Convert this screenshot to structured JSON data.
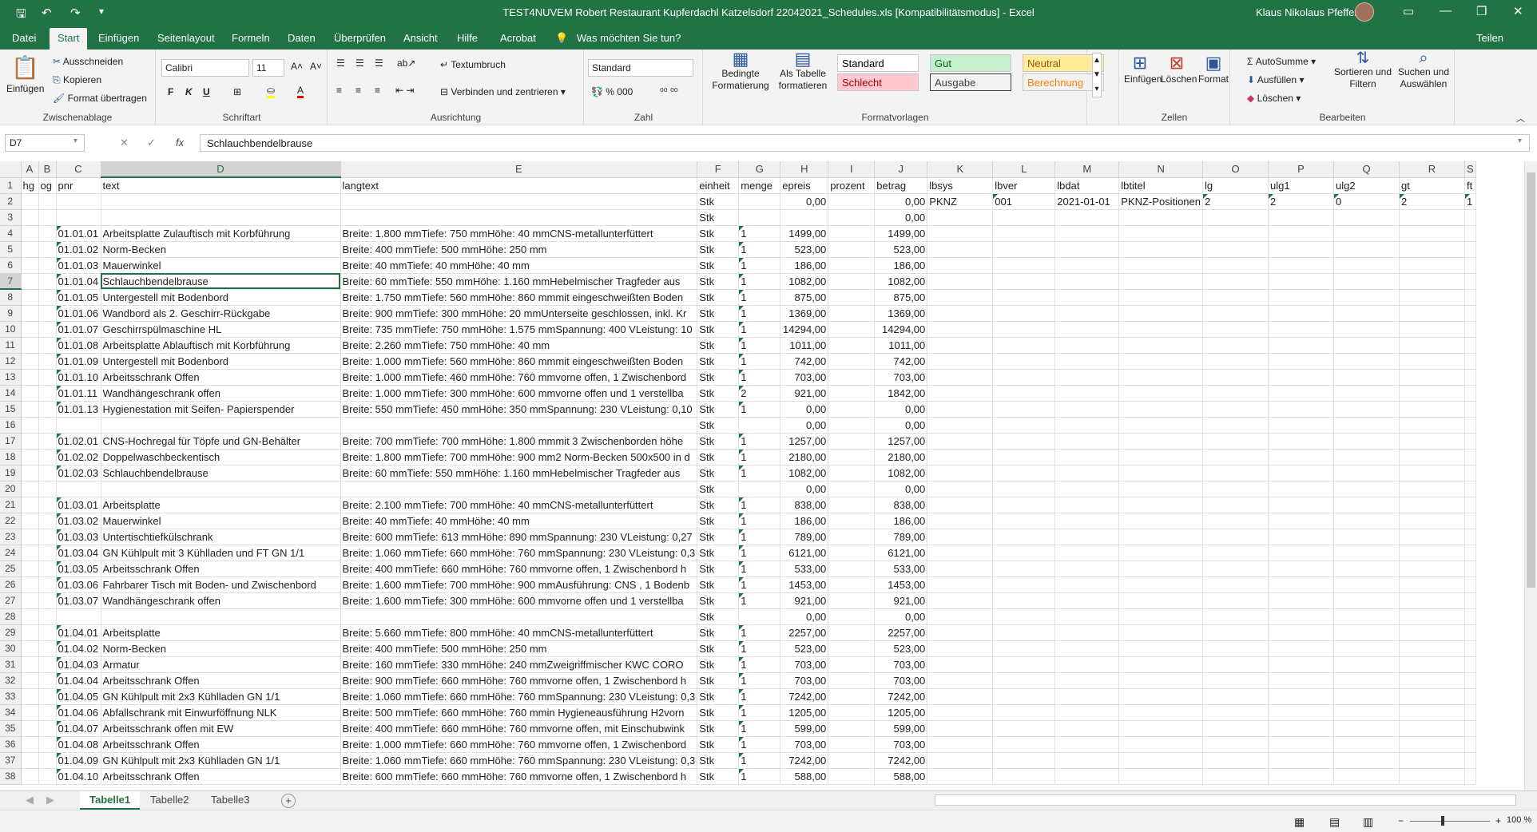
{
  "window": {
    "title": "TEST4NUVEM Robert Restaurant Kupferdachl Katzelsdorf 22042021_Schedules.xls  [Kompatibilitätsmodus]  -  Excel",
    "user": "Klaus Nikolaus Pfeffer"
  },
  "menu": {
    "items": [
      "Datei",
      "Start",
      "Einfügen",
      "Seitenlayout",
      "Formeln",
      "Daten",
      "Überprüfen",
      "Ansicht",
      "Hilfe",
      "Acrobat"
    ],
    "tell_me": "Was möchten Sie tun?",
    "share": "Teilen"
  },
  "ribbon": {
    "clipboard": {
      "label": "Zwischenablage",
      "paste": "Einfügen",
      "cut": "Ausschneiden",
      "copy": "Kopieren",
      "format_painter": "Format übertragen"
    },
    "font": {
      "label": "Schriftart",
      "name": "Calibri",
      "size": "11",
      "bold": "F",
      "italic": "K",
      "underline": "U"
    },
    "alignment": {
      "label": "Ausrichtung",
      "wrap": "Textumbruch",
      "merge": "Verbinden und zentrieren"
    },
    "number": {
      "label": "Zahl",
      "format": "Standard"
    },
    "styles": {
      "label": "Formatvorlagen",
      "conditional": "Bedingte Formatierung",
      "as_table": "Als Tabelle formatieren",
      "cells": [
        {
          "name": "Standard",
          "bg": "#ffffff",
          "fg": "#000000"
        },
        {
          "name": "Gut",
          "bg": "#c6efce",
          "fg": "#006100"
        },
        {
          "name": "Neutral",
          "bg": "#ffeb9c",
          "fg": "#9c5700"
        },
        {
          "name": "Schlecht",
          "bg": "#ffc7ce",
          "fg": "#9c0006"
        },
        {
          "name": "Ausgabe",
          "bg": "#f2f2f2",
          "fg": "#3f3f3f"
        },
        {
          "name": "Berechnung",
          "bg": "#f2f2f2",
          "fg": "#fa7d00"
        }
      ]
    },
    "cells": {
      "label": "Zellen",
      "insert": "Einfügen",
      "delete": "Löschen",
      "format": "Format"
    },
    "editing": {
      "label": "Bearbeiten",
      "autosum": "AutoSumme",
      "fill": "Ausfüllen",
      "clear": "Löschen",
      "sort": "Sortieren und Filtern",
      "find": "Suchen und Auswählen"
    }
  },
  "formula_bar": {
    "name_box": "D7",
    "value": "Schlauchbendelbrause"
  },
  "columns": [
    "A",
    "B",
    "C",
    "D",
    "E",
    "F",
    "G",
    "H",
    "I",
    "J",
    "K",
    "L",
    "M",
    "N",
    "O",
    "P",
    "Q",
    "R",
    "S"
  ],
  "rows": [
    [
      "hg",
      "og",
      "pnr",
      "text",
      "langtext",
      "einheit",
      "menge",
      "epreis",
      "prozent",
      "betrag",
      "lbsys",
      "lbver",
      "lbdat",
      "lbtitel",
      "lg",
      "ulg1",
      "ulg2",
      "gt",
      "ft"
    ],
    [
      "",
      "",
      "",
      "",
      "",
      "Stk",
      "",
      "0,00",
      "",
      "0,00",
      "PKNZ",
      "001",
      "2021-01-01",
      "PKNZ-Positionen",
      "2",
      "2",
      "0",
      "2",
      "1"
    ],
    [
      "",
      "",
      "",
      "",
      "",
      "Stk",
      "",
      "",
      "",
      "0,00",
      "",
      "",
      "",
      "",
      "",
      "",
      "",
      "",
      ""
    ],
    [
      "",
      "",
      "01.01.01",
      "Arbeitsplatte Zulauftisch mit Korbführung",
      "Breite: 1.800 mmTiefe: 750 mmHöhe: 40 mmCNS-metallunterfüttert",
      "Stk",
      "1",
      "1499,00",
      "",
      "1499,00",
      "",
      "",
      "",
      "",
      "",
      "",
      "",
      "",
      ""
    ],
    [
      "",
      "",
      "01.01.02",
      "Norm-Becken",
      "Breite: 400 mmTiefe: 500 mmHöhe: 250 mm",
      "Stk",
      "1",
      "523,00",
      "",
      "523,00",
      "",
      "",
      "",
      "",
      "",
      "",
      "",
      "",
      ""
    ],
    [
      "",
      "",
      "01.01.03",
      "Mauerwinkel",
      "Breite: 40 mmTiefe: 40 mmHöhe: 40 mm",
      "Stk",
      "1",
      "186,00",
      "",
      "186,00",
      "",
      "",
      "",
      "",
      "",
      "",
      "",
      "",
      ""
    ],
    [
      "",
      "",
      "01.01.04",
      "Schlauchbendelbrause",
      "Breite: 60 mmTiefe: 550 mmHöhe: 1.160 mmHebelmischer    Tragfeder aus",
      "Stk",
      "1",
      "1082,00",
      "",
      "1082,00",
      "",
      "",
      "",
      "",
      "",
      "",
      "",
      "",
      ""
    ],
    [
      "",
      "",
      "01.01.05",
      "Untergestell mit Bodenbord",
      "Breite: 1.750 mmTiefe: 560 mmHöhe: 860 mmmit eingeschweißten Boden",
      "Stk",
      "1",
      "875,00",
      "",
      "875,00",
      "",
      "",
      "",
      "",
      "",
      "",
      "",
      "",
      ""
    ],
    [
      "",
      "",
      "01.01.06",
      "Wandbord als 2. Geschirr-Rückgabe",
      "Breite: 900 mmTiefe: 300 mmHöhe: 20 mmUnterseite geschlossen, inkl. Kr",
      "Stk",
      "1",
      "1369,00",
      "",
      "1369,00",
      "",
      "",
      "",
      "",
      "",
      "",
      "",
      "",
      ""
    ],
    [
      "",
      "",
      "01.01.07",
      "Geschirrspülmaschine HL",
      "Breite: 735 mmTiefe: 750 mmHöhe: 1.575 mmSpannung: 400 VLeistung: 10",
      "Stk",
      "1",
      "14294,00",
      "",
      "14294,00",
      "",
      "",
      "",
      "",
      "",
      "",
      "",
      "",
      ""
    ],
    [
      "",
      "",
      "01.01.08",
      "Arbeitsplatte Ablauftisch mit Korbführung",
      "Breite: 2.260 mmTiefe: 750 mmHöhe: 40 mm",
      "Stk",
      "1",
      "1011,00",
      "",
      "1011,00",
      "",
      "",
      "",
      "",
      "",
      "",
      "",
      "",
      ""
    ],
    [
      "",
      "",
      "01.01.09",
      "Untergestell mit Bodenbord",
      "Breite: 1.000 mmTiefe: 560 mmHöhe: 860 mmmit eingeschweißten Boden",
      "Stk",
      "1",
      "742,00",
      "",
      "742,00",
      "",
      "",
      "",
      "",
      "",
      "",
      "",
      "",
      ""
    ],
    [
      "",
      "",
      "01.01.10",
      "Arbeitsschrank  Offen",
      "Breite: 1.000 mmTiefe: 460 mmHöhe: 760 mmvorne offen, 1 Zwischenbord",
      "Stk",
      "1",
      "703,00",
      "",
      "703,00",
      "",
      "",
      "",
      "",
      "",
      "",
      "",
      "",
      ""
    ],
    [
      "",
      "",
      "01.01.11",
      "Wandhängeschrank offen",
      "Breite: 1.000 mmTiefe: 300 mmHöhe: 600 mmvorne offen und 1 verstellba",
      "Stk",
      "2",
      "921,00",
      "",
      "1842,00",
      "",
      "",
      "",
      "",
      "",
      "",
      "",
      "",
      ""
    ],
    [
      "",
      "",
      "01.01.13",
      "Hygienestation mit Seifen- Papierspender",
      "Breite: 550 mmTiefe: 450 mmHöhe: 350 mmSpannung: 230 VLeistung: 0,10",
      "Stk",
      "1",
      "0,00",
      "",
      "0,00",
      "",
      "",
      "",
      "",
      "",
      "",
      "",
      "",
      ""
    ],
    [
      "",
      "",
      "",
      "",
      "",
      "Stk",
      "",
      "0,00",
      "",
      "0,00",
      "",
      "",
      "",
      "",
      "",
      "",
      "",
      "",
      ""
    ],
    [
      "",
      "",
      "01.02.01",
      "CNS-Hochregal für Töpfe und GN-Behälter",
      "Breite: 700 mmTiefe: 700 mmHöhe: 1.800 mmmit 3 Zwischenborden höhe",
      "Stk",
      "1",
      "1257,00",
      "",
      "1257,00",
      "",
      "",
      "",
      "",
      "",
      "",
      "",
      "",
      ""
    ],
    [
      "",
      "",
      "01.02.02",
      "Doppelwaschbeckentisch",
      "Breite: 1.800 mmTiefe: 700 mmHöhe: 900 mm2 Norm-Becken 500x500 in d",
      "Stk",
      "1",
      "2180,00",
      "",
      "2180,00",
      "",
      "",
      "",
      "",
      "",
      "",
      "",
      "",
      ""
    ],
    [
      "",
      "",
      "01.02.03",
      "Schlauchbendelbrause",
      "Breite: 60 mmTiefe: 550 mmHöhe: 1.160 mmHebelmischer    Tragfeder aus",
      "Stk",
      "1",
      "1082,00",
      "",
      "1082,00",
      "",
      "",
      "",
      "",
      "",
      "",
      "",
      "",
      ""
    ],
    [
      "",
      "",
      "",
      "",
      "",
      "Stk",
      "",
      "0,00",
      "",
      "0,00",
      "",
      "",
      "",
      "",
      "",
      "",
      "",
      "",
      ""
    ],
    [
      "",
      "",
      "01.03.01",
      "Arbeitsplatte",
      "Breite: 2.100 mmTiefe: 700 mmHöhe: 40 mmCNS-metallunterfüttert",
      "Stk",
      "1",
      "838,00",
      "",
      "838,00",
      "",
      "",
      "",
      "",
      "",
      "",
      "",
      "",
      ""
    ],
    [
      "",
      "",
      "01.03.02",
      "Mauerwinkel",
      "Breite: 40 mmTiefe: 40 mmHöhe: 40 mm",
      "Stk",
      "1",
      "186,00",
      "",
      "186,00",
      "",
      "",
      "",
      "",
      "",
      "",
      "",
      "",
      ""
    ],
    [
      "",
      "",
      "01.03.03",
      "Untertischtiefkülschrank",
      "Breite: 600 mmTiefe: 613 mmHöhe: 890 mmSpannung: 230 VLeistung: 0,27",
      "Stk",
      "1",
      "789,00",
      "",
      "789,00",
      "",
      "",
      "",
      "",
      "",
      "",
      "",
      "",
      ""
    ],
    [
      "",
      "",
      "01.03.04",
      "GN Kühlpult mit 3 Kühlladen und FT GN 1/1",
      "Breite: 1.060 mmTiefe: 660 mmHöhe: 760 mmSpannung: 230 VLeistung: 0,3",
      "Stk",
      "1",
      "6121,00",
      "",
      "6121,00",
      "",
      "",
      "",
      "",
      "",
      "",
      "",
      "",
      ""
    ],
    [
      "",
      "",
      "01.03.05",
      "Arbeitsschrank  Offen",
      "Breite: 400 mmTiefe: 660 mmHöhe: 760 mmvorne offen, 1 Zwischenbord h",
      "Stk",
      "1",
      "533,00",
      "",
      "533,00",
      "",
      "",
      "",
      "",
      "",
      "",
      "",
      "",
      ""
    ],
    [
      "",
      "",
      "01.03.06",
      "Fahrbarer Tisch mit Boden- und Zwischenbord",
      "Breite: 1.600 mmTiefe: 700 mmHöhe: 900 mmAusführung: CNS , 1 Bodenb",
      "Stk",
      "1",
      "1453,00",
      "",
      "1453,00",
      "",
      "",
      "",
      "",
      "",
      "",
      "",
      "",
      ""
    ],
    [
      "",
      "",
      "01.03.07",
      "Wandhängeschrank offen",
      "Breite: 1.600 mmTiefe: 300 mmHöhe: 600 mmvorne offen und 1 verstellba",
      "Stk",
      "1",
      "921,00",
      "",
      "921,00",
      "",
      "",
      "",
      "",
      "",
      "",
      "",
      "",
      ""
    ],
    [
      "",
      "",
      "",
      "",
      "",
      "Stk",
      "",
      "0,00",
      "",
      "0,00",
      "",
      "",
      "",
      "",
      "",
      "",
      "",
      "",
      ""
    ],
    [
      "",
      "",
      "01.04.01",
      "Arbeitsplatte",
      "Breite: 5.660 mmTiefe: 800 mmHöhe: 40 mmCNS-metallunterfüttert",
      "Stk",
      "1",
      "2257,00",
      "",
      "2257,00",
      "",
      "",
      "",
      "",
      "",
      "",
      "",
      "",
      ""
    ],
    [
      "",
      "",
      "01.04.02",
      "Norm-Becken",
      "Breite: 400 mmTiefe: 500 mmHöhe: 250 mm",
      "Stk",
      "1",
      "523,00",
      "",
      "523,00",
      "",
      "",
      "",
      "",
      "",
      "",
      "",
      "",
      ""
    ],
    [
      "",
      "",
      "01.04.03",
      "Armatur",
      "Breite: 160 mmTiefe: 330 mmHöhe: 240 mmZweigriffmischer    KWC CORO",
      "Stk",
      "1",
      "703,00",
      "",
      "703,00",
      "",
      "",
      "",
      "",
      "",
      "",
      "",
      "",
      ""
    ],
    [
      "",
      "",
      "01.04.04",
      "Arbeitsschrank  Offen",
      "Breite: 900 mmTiefe: 660 mmHöhe: 760 mmvorne offen, 1 Zwischenbord h",
      "Stk",
      "1",
      "703,00",
      "",
      "703,00",
      "",
      "",
      "",
      "",
      "",
      "",
      "",
      "",
      ""
    ],
    [
      "",
      "",
      "01.04.05",
      "GN Kühlpult mit 2x3 Kühlladen  GN 1/1",
      "Breite: 1.060 mmTiefe: 660 mmHöhe: 760 mmSpannung: 230 VLeistung: 0,3",
      "Stk",
      "1",
      "7242,00",
      "",
      "7242,00",
      "",
      "",
      "",
      "",
      "",
      "",
      "",
      "",
      ""
    ],
    [
      "",
      "",
      "01.04.06",
      "Abfallschrank mit Einwurföffnung NLK",
      "Breite: 500 mmTiefe: 660 mmHöhe: 760 mmin Hygieneausführung H2vorn",
      "Stk",
      "1",
      "1205,00",
      "",
      "1205,00",
      "",
      "",
      "",
      "",
      "",
      "",
      "",
      "",
      ""
    ],
    [
      "",
      "",
      "01.04.07",
      "Arbeitsschrank offen mit EW",
      "Breite: 400 mmTiefe: 660 mmHöhe: 760 mmvorne offen, mit Einschubwink",
      "Stk",
      "1",
      "599,00",
      "",
      "599,00",
      "",
      "",
      "",
      "",
      "",
      "",
      "",
      "",
      ""
    ],
    [
      "",
      "",
      "01.04.08",
      "Arbeitsschrank  Offen",
      "Breite: 1.000 mmTiefe: 660 mmHöhe: 760 mmvorne offen, 1 Zwischenbord",
      "Stk",
      "1",
      "703,00",
      "",
      "703,00",
      "",
      "",
      "",
      "",
      "",
      "",
      "",
      "",
      ""
    ],
    [
      "",
      "",
      "01.04.09",
      "GN Kühlpult mit 2x3 Kühlladen  GN 1/1",
      "Breite: 1.060 mmTiefe: 660 mmHöhe: 760 mmSpannung: 230 VLeistung: 0,3",
      "Stk",
      "1",
      "7242,00",
      "",
      "7242,00",
      "",
      "",
      "",
      "",
      "",
      "",
      "",
      "",
      ""
    ],
    [
      "",
      "",
      "01.04.10",
      "Arbeitsschrank  Offen",
      "Breite: 600 mmTiefe: 660 mmHöhe: 760 mmvorne offen, 1 Zwischenbord h",
      "Stk",
      "1",
      "588,00",
      "",
      "588,00",
      "",
      "",
      "",
      "",
      "",
      "",
      "",
      "",
      ""
    ]
  ],
  "sheets": [
    "Tabelle1",
    "Tabelle2",
    "Tabelle3"
  ],
  "status": {
    "zoom": "100 %"
  }
}
